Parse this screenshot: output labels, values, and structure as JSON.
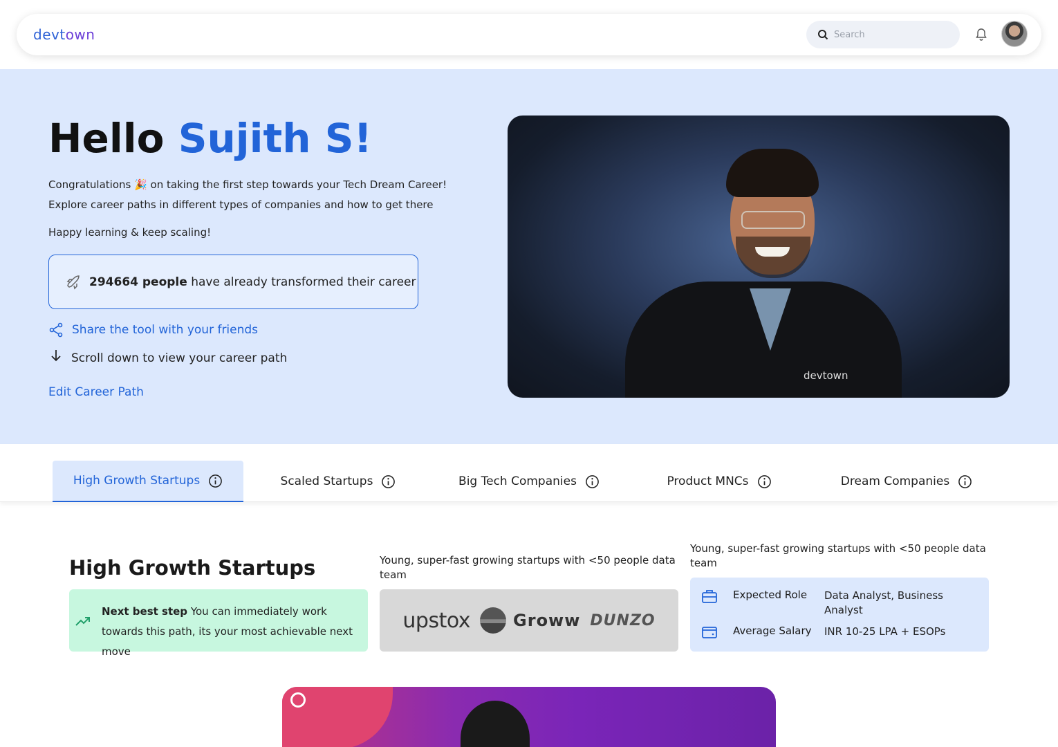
{
  "header": {
    "logo_main": "devt",
    "logo_accent": "own",
    "search_placeholder": "Search"
  },
  "hero": {
    "greeting": "Hello",
    "name": "Sujith S!",
    "line1": "Congratulations 🎉 on taking the first step towards your Tech Dream Career!",
    "line2": "Explore career paths in different types of companies and how to get there",
    "line3": "Happy learning & keep scaling!",
    "stat_count": "294664 people",
    "stat_text": " have already transformed their career",
    "share_label": "Share the tool with your friends",
    "scroll_label": "Scroll down to view your career path",
    "edit_label": "Edit Career Path",
    "video_shirt_logo": "devtown"
  },
  "tabs": [
    {
      "label": "High Growth Startups",
      "active": true
    },
    {
      "label": "Scaled Startups",
      "active": false
    },
    {
      "label": "Big Tech Companies",
      "active": false
    },
    {
      "label": "Product MNCs",
      "active": false
    },
    {
      "label": "Dream Companies",
      "active": false
    }
  ],
  "section": {
    "title": "High Growth Startups",
    "next_step_bold": "Next best step",
    "next_step_text": " You can immediately work towards this path, its your most achievable next move",
    "desc_logos": "Young, super-fast growing startups with <50 people data team",
    "desc_role": "Young, super-fast growing startups with <50 people data team",
    "logos": [
      "upstox",
      "Groww",
      "DUNZO"
    ],
    "expected_role_label": "Expected Role",
    "expected_role_value": "Data Analyst, Business Analyst",
    "avg_salary_label": "Average Salary",
    "avg_salary_value": "INR 10-25 LPA + ESOPs"
  },
  "colors": {
    "accent": "#2264d8",
    "hero_bg": "#dce8fd",
    "next_step_bg": "#c7f7df"
  }
}
